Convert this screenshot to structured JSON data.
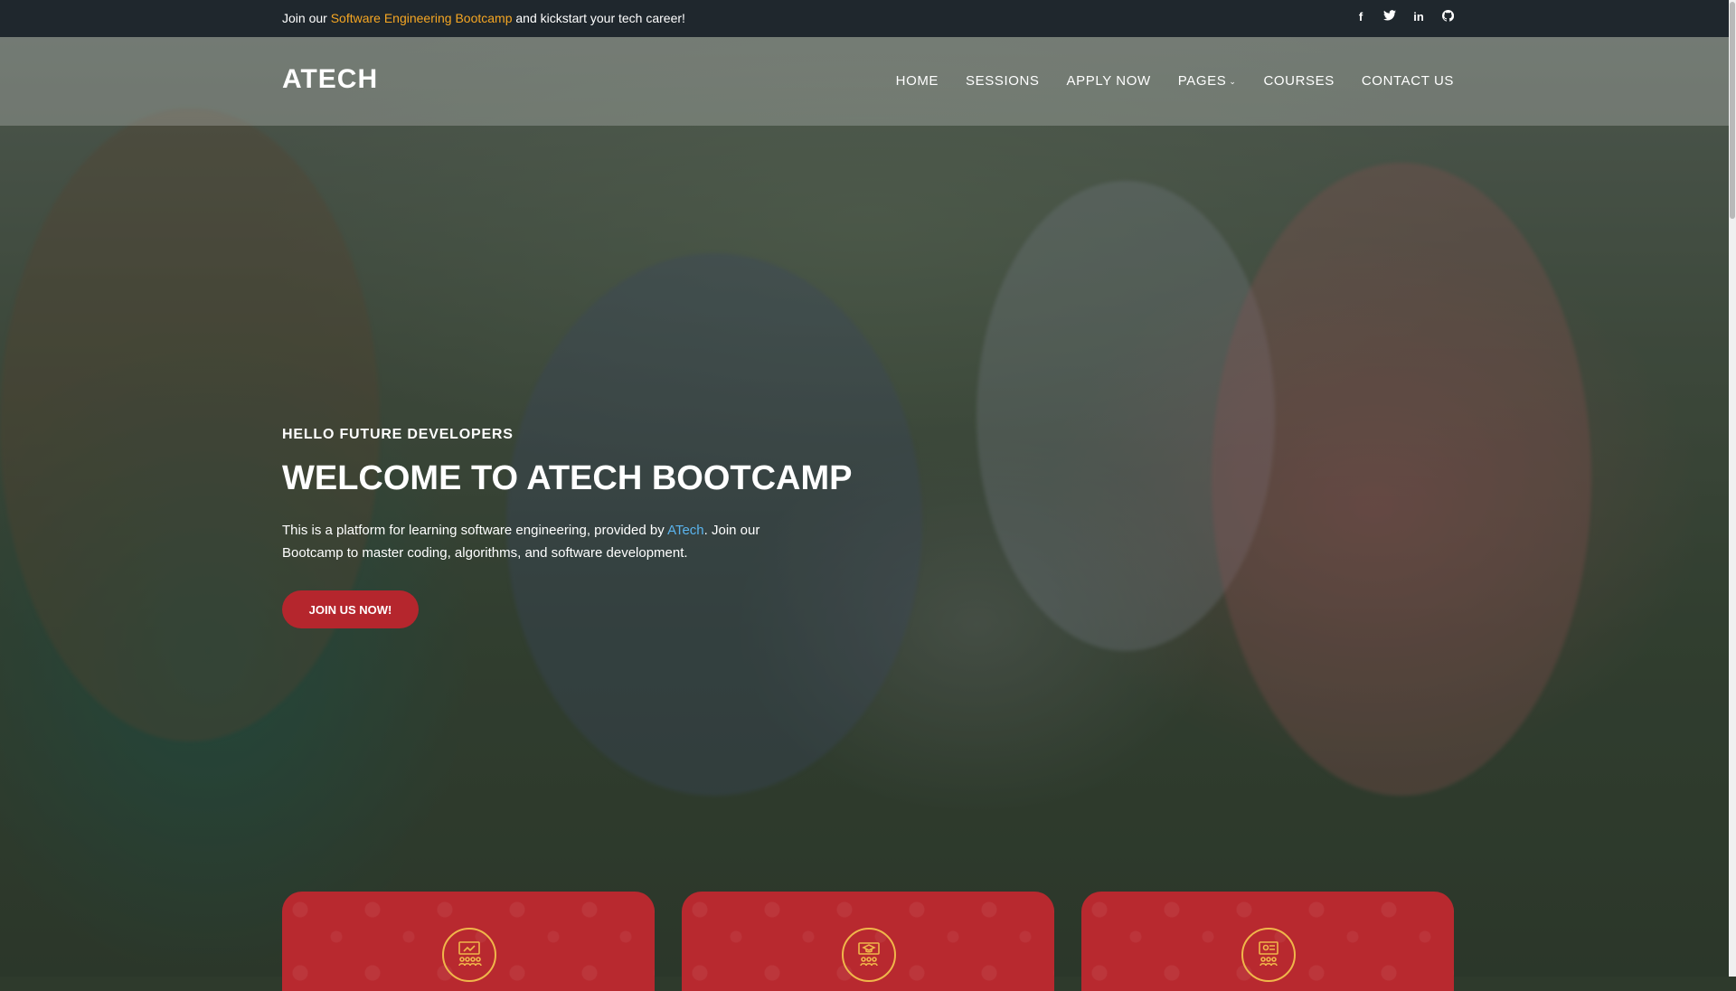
{
  "topbar": {
    "message_prefix": "Join our ",
    "message_highlight": "Software Engineering Bootcamp",
    "message_suffix": " and kickstart your tech career!",
    "highlight_color": "#f5a623",
    "social_icons": [
      "facebook-icon",
      "twitter-icon",
      "linkedin-icon",
      "github-icon"
    ]
  },
  "navbar": {
    "brand": "ATECH",
    "items": [
      {
        "label": "HOME"
      },
      {
        "label": "SESSIONS"
      },
      {
        "label": "APPLY NOW"
      },
      {
        "label": "PAGES"
      },
      {
        "label": "COURSES"
      },
      {
        "label": "CONTACT US"
      }
    ]
  },
  "hero": {
    "eyebrow": "HELLO FUTURE DEVELOPERS",
    "title": "WELCOME TO ATECH BOOTCAMP",
    "text_prefix": "This is a platform for learning software engineering, provided by ",
    "text_link": "ATech",
    "text_suffix": ". Join our Bootcamp to master coding, algorithms, and software development.",
    "cta_label": "JOIN US NOW!",
    "cta_color": "#b5262d"
  },
  "feature_cards": {
    "card_color": "#b8292f",
    "icon_border_color": "#f0b64a",
    "icons": [
      "online-class-icon",
      "graduation-presentation-icon",
      "classroom-board-icon"
    ]
  }
}
